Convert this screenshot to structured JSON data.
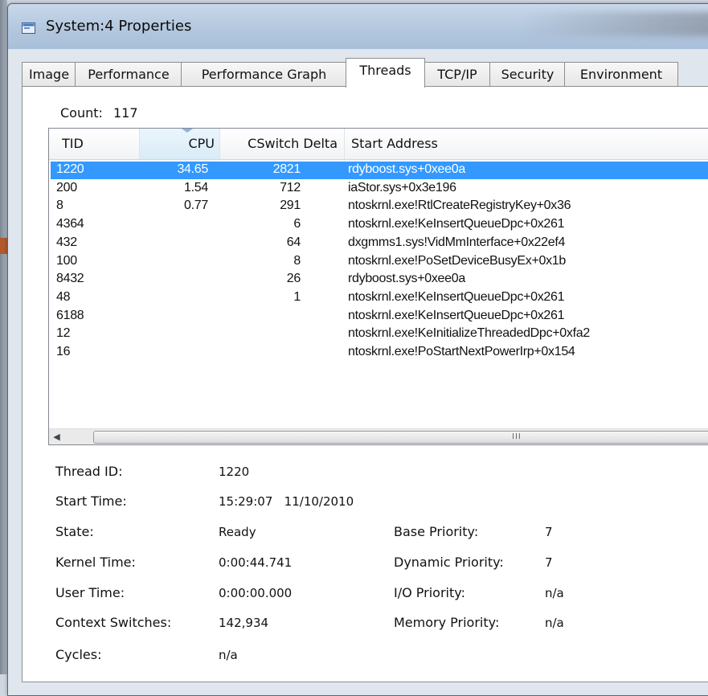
{
  "window": {
    "title": "System:4 Properties"
  },
  "tabs": [
    {
      "label": "Image",
      "active": false
    },
    {
      "label": "Performance",
      "active": false
    },
    {
      "label": "Performance Graph",
      "active": false
    },
    {
      "label": "Threads",
      "active": true
    },
    {
      "label": "TCP/IP",
      "active": false
    },
    {
      "label": "Security",
      "active": false
    },
    {
      "label": "Environment",
      "active": false
    }
  ],
  "threads": {
    "count_label": "Count:",
    "count_value": "117",
    "columns": [
      "TID",
      "CPU",
      "CSwitch Delta",
      "Start Address"
    ],
    "sorted_column": "CPU",
    "rows": [
      {
        "tid": "1220",
        "cpu": "34.65",
        "cswitch": "2821",
        "address": "rdyboost.sys+0xee0a",
        "selected": true
      },
      {
        "tid": "200",
        "cpu": "1.54",
        "cswitch": "712",
        "address": "iaStor.sys+0x3e196"
      },
      {
        "tid": "8",
        "cpu": "0.77",
        "cswitch": "291",
        "address": "ntoskrnl.exe!RtlCreateRegistryKey+0x36"
      },
      {
        "tid": "4364",
        "cpu": "",
        "cswitch": "6",
        "address": "ntoskrnl.exe!KeInsertQueueDpc+0x261"
      },
      {
        "tid": "432",
        "cpu": "",
        "cswitch": "64",
        "address": "dxgmms1.sys!VidMmInterface+0x22ef4"
      },
      {
        "tid": "100",
        "cpu": "",
        "cswitch": "8",
        "address": "ntoskrnl.exe!PoSetDeviceBusyEx+0x1b"
      },
      {
        "tid": "8432",
        "cpu": "",
        "cswitch": "26",
        "address": "rdyboost.sys+0xee0a"
      },
      {
        "tid": "48",
        "cpu": "",
        "cswitch": "1",
        "address": "ntoskrnl.exe!KeInsertQueueDpc+0x261"
      },
      {
        "tid": "6188",
        "cpu": "",
        "cswitch": "",
        "address": "ntoskrnl.exe!KeInsertQueueDpc+0x261"
      },
      {
        "tid": "12",
        "cpu": "",
        "cswitch": "",
        "address": "ntoskrnl.exe!KeInitializeThreadedDpc+0xfa2"
      },
      {
        "tid": "16",
        "cpu": "",
        "cswitch": "",
        "address": "ntoskrnl.exe!PoStartNextPowerIrp+0x154"
      }
    ],
    "scroll_grip": "III"
  },
  "details": {
    "thread_id": {
      "label": "Thread ID:",
      "value": "1220"
    },
    "start_time": {
      "label": "Start Time:",
      "value": "15:29:07   11/10/2010"
    },
    "state": {
      "label": "State:",
      "value": "Ready"
    },
    "kernel_time": {
      "label": "Kernel Time:",
      "value": "0:00:44.741"
    },
    "user_time": {
      "label": "User Time:",
      "value": "0:00:00.000"
    },
    "context_switches": {
      "label": "Context Switches:",
      "value": "142,934"
    },
    "cycles": {
      "label": "Cycles:",
      "value": "n/a"
    },
    "base_priority": {
      "label": "Base Priority:",
      "value": "7"
    },
    "dynamic_priority": {
      "label": "Dynamic Priority:",
      "value": "7"
    },
    "io_priority": {
      "label": "I/O Priority:",
      "value": "n/a"
    },
    "memory_priority": {
      "label": "Memory Priority:",
      "value": "n/a"
    }
  },
  "colors": {
    "selection": "#3399ff",
    "sorted_header": "#d9ecf8"
  },
  "icons": {
    "app": "properties-window-icon",
    "scroll_left": "scroll-left-arrow-icon",
    "sort": "sort-descending-icon"
  }
}
